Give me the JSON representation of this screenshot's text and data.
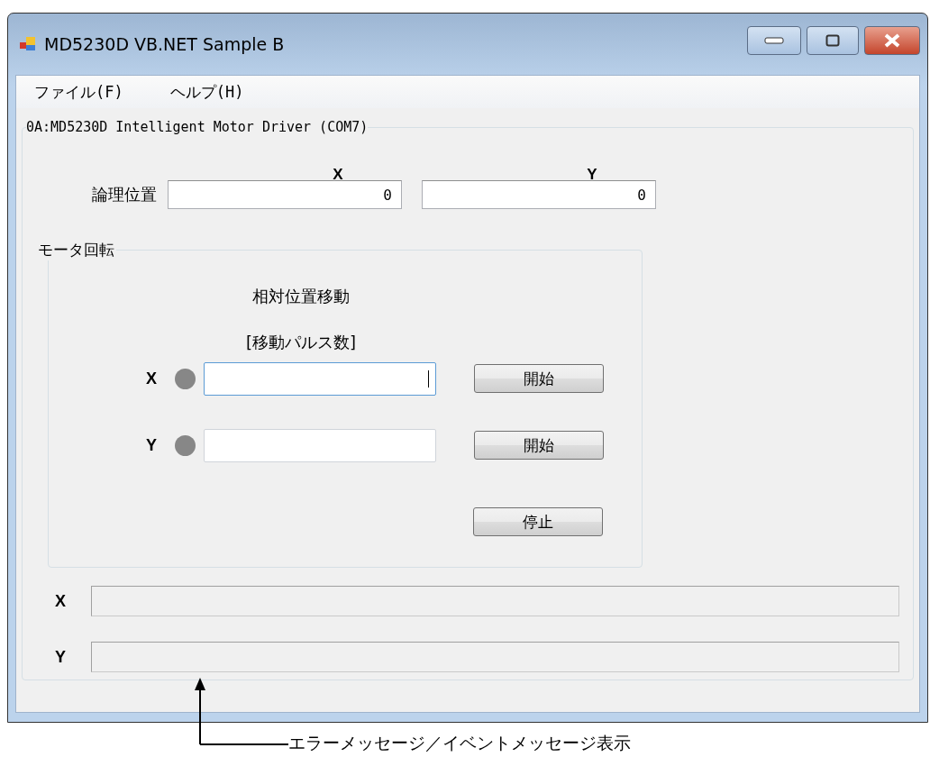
{
  "window": {
    "title": "MD5230D VB.NET Sample B"
  },
  "menu": [
    {
      "label": "ファイル(F)"
    },
    {
      "label": "ヘルプ(H)"
    }
  ],
  "device_group": {
    "title": "0A:MD5230D Intelligent Motor Driver (COM7)",
    "columns": [
      "X",
      "Y"
    ],
    "position": {
      "label": "論理位置",
      "values": [
        "0",
        "0"
      ]
    },
    "motor_group": {
      "title": "モータ回転",
      "heading": "相対位置移動",
      "subheading": "[移動パルス数]",
      "axes": [
        {
          "label": "X",
          "active": false,
          "focused": true,
          "button": "開始"
        },
        {
          "label": "Y",
          "active": false,
          "focused": false,
          "button": "開始"
        }
      ],
      "stop_button": "停止"
    },
    "messages": [
      {
        "label": "X"
      },
      {
        "label": "Y"
      }
    ]
  },
  "annotation": "エラーメッセージ／イベントメッセージ表示"
}
